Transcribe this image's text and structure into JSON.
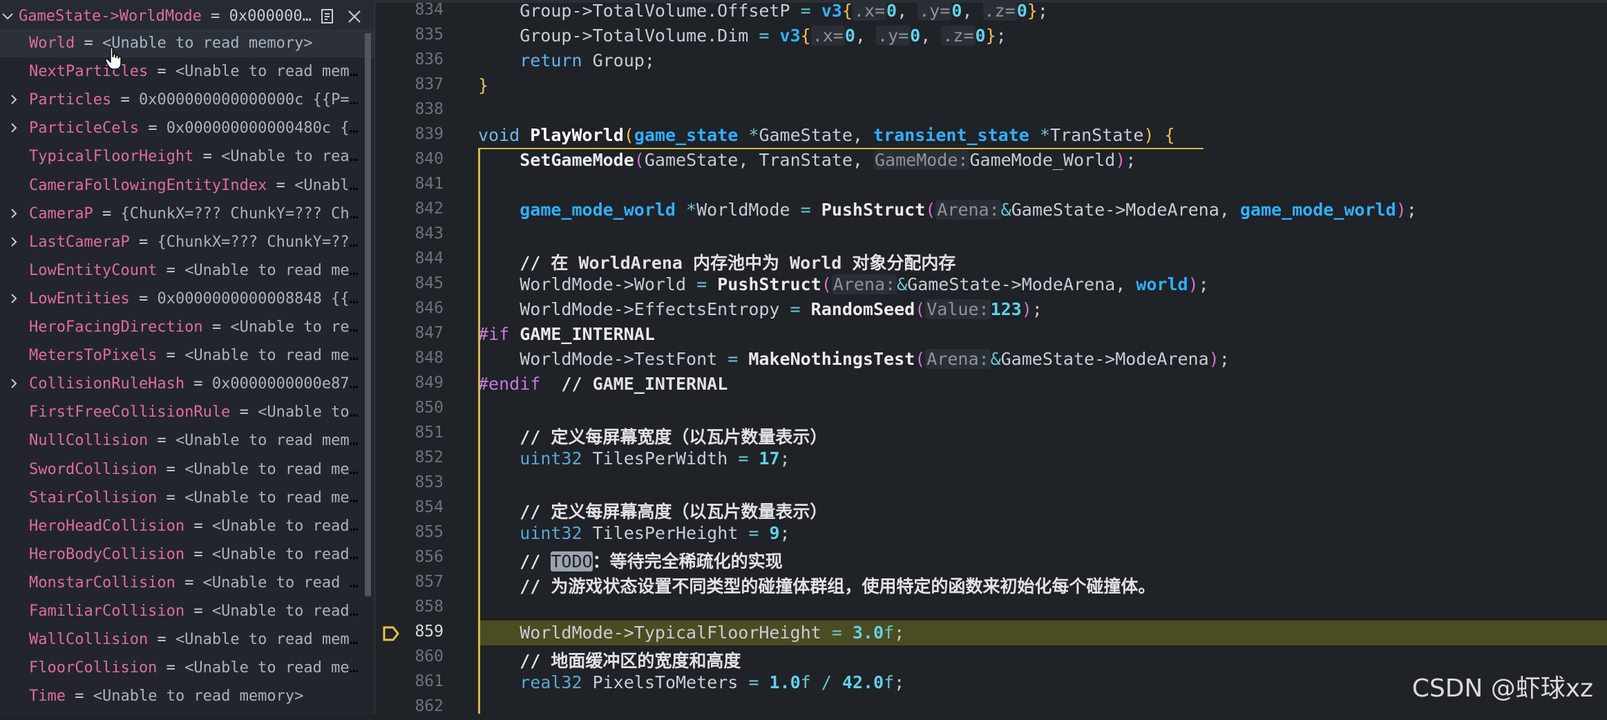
{
  "watch": {
    "header": {
      "name": "GameState->WorldMode",
      "eq": " = ",
      "value": "0x000000…"
    },
    "rows": [
      {
        "name": "World",
        "value": "<Unable to read memory>",
        "expandable": false
      },
      {
        "name": "NextParticles",
        "value": "<Unable to read memo…",
        "expandable": false
      },
      {
        "name": "Particles",
        "value": "0x000000000000000c {{P={…",
        "expandable": true
      },
      {
        "name": "ParticleCels",
        "value": "0x000000000000480c {0…",
        "expandable": true
      },
      {
        "name": "TypicalFloorHeight",
        "value": "<Unable to read…",
        "expandable": false
      },
      {
        "name": "CameraFollowingEntityIndex",
        "value": "<Unable…",
        "expandable": false
      },
      {
        "name": "CameraP",
        "value": "{ChunkX=??? ChunkY=??? Chu…",
        "expandable": true
      },
      {
        "name": "LastCameraP",
        "value": "{ChunkX=??? ChunkY=???…",
        "expandable": true
      },
      {
        "name": "LowEntityCount",
        "value": "<Unable to read mem…",
        "expandable": false
      },
      {
        "name": "LowEntities",
        "value": "0x0000000000008848 {{S…",
        "expandable": true
      },
      {
        "name": "HeroFacingDirection",
        "value": "<Unable to rea…",
        "expandable": false
      },
      {
        "name": "MetersToPixels",
        "value": "<Unable to read mem…",
        "expandable": false
      },
      {
        "name": "CollisionRuleHash",
        "value": "0x0000000000e877…",
        "expandable": true
      },
      {
        "name": "FirstFreeCollisionRule",
        "value": "<Unable to …",
        "expandable": false
      },
      {
        "name": "NullCollision",
        "value": "<Unable to read memo…",
        "expandable": false
      },
      {
        "name": "SwordCollision",
        "value": "<Unable to read mem…",
        "expandable": false
      },
      {
        "name": "StairCollision",
        "value": "<Unable to read mem…",
        "expandable": false
      },
      {
        "name": "HeroHeadCollision",
        "value": "<Unable to read …",
        "expandable": false
      },
      {
        "name": "HeroBodyCollision",
        "value": "<Unable to read …",
        "expandable": false
      },
      {
        "name": "MonstarCollision",
        "value": "<Unable to read m…",
        "expandable": false
      },
      {
        "name": "FamiliarCollision",
        "value": "<Unable to read …",
        "expandable": false
      },
      {
        "name": "WallCollision",
        "value": "<Unable to read memo…",
        "expandable": false
      },
      {
        "name": "FloorCollision",
        "value": "<Unable to read mem…",
        "expandable": false
      },
      {
        "name": "Time",
        "value": "<Unable to read memory>",
        "expandable": false
      }
    ]
  },
  "editor": {
    "lines": [
      {
        "n": "834",
        "segs": [
          [
            "",
            "    Group->TotalVolume.OffsetP "
          ],
          [
            "op",
            "="
          ],
          [
            "",
            " "
          ],
          [
            "ty",
            "v3"
          ],
          [
            "brk",
            "{"
          ],
          [
            "hint",
            ".x="
          ],
          [
            "num",
            "0"
          ],
          [
            "",
            ", "
          ],
          [
            "hint",
            ".y="
          ],
          [
            "num",
            "0"
          ],
          [
            "",
            ", "
          ],
          [
            "hint",
            ".z="
          ],
          [
            "num",
            "0"
          ],
          [
            "brk",
            "}"
          ],
          [
            "",
            ";"
          ]
        ]
      },
      {
        "n": "835",
        "segs": [
          [
            "",
            "    Group->TotalVolume.Dim "
          ],
          [
            "op",
            "="
          ],
          [
            "",
            " "
          ],
          [
            "ty",
            "v3"
          ],
          [
            "brk",
            "{"
          ],
          [
            "hint",
            ".x="
          ],
          [
            "num",
            "0"
          ],
          [
            "",
            ", "
          ],
          [
            "hint",
            ".y="
          ],
          [
            "num",
            "0"
          ],
          [
            "",
            ", "
          ],
          [
            "hint",
            ".z="
          ],
          [
            "num",
            "0"
          ],
          [
            "brk",
            "}"
          ],
          [
            "",
            ";"
          ]
        ]
      },
      {
        "n": "836",
        "segs": [
          [
            "",
            "    "
          ],
          [
            "kw",
            "return"
          ],
          [
            "",
            " Group;"
          ]
        ]
      },
      {
        "n": "837",
        "segs": [
          [
            "brk",
            "}"
          ]
        ]
      },
      {
        "n": "838",
        "segs": []
      },
      {
        "n": "839",
        "segs": [
          [
            "kw2",
            "void"
          ],
          [
            "",
            " "
          ],
          [
            "fn",
            "PlayWorld"
          ],
          [
            "brk",
            "("
          ],
          [
            "ty",
            "game_state"
          ],
          [
            "",
            " "
          ],
          [
            "ptr",
            "*"
          ],
          [
            "",
            "GameState, "
          ],
          [
            "ty",
            "transient_state"
          ],
          [
            "",
            " "
          ],
          [
            "ptr",
            "*"
          ],
          [
            "",
            "TranState"
          ],
          [
            "brk",
            ")"
          ],
          [
            "",
            " "
          ],
          [
            "brk",
            "{"
          ]
        ]
      },
      {
        "n": "840",
        "segs": [
          [
            "",
            "    "
          ],
          [
            "fn2",
            "SetGameMode"
          ],
          [
            "brk2",
            "("
          ],
          [
            "",
            "GameState, TranState, "
          ],
          [
            "hint",
            "GameMode:"
          ],
          [
            "",
            "GameMode_World"
          ],
          [
            "brk2",
            ")"
          ],
          [
            "",
            ";"
          ]
        ]
      },
      {
        "n": "841",
        "segs": []
      },
      {
        "n": "842",
        "segs": [
          [
            "",
            "    "
          ],
          [
            "ty",
            "game_mode_world"
          ],
          [
            "",
            " "
          ],
          [
            "ptr",
            "*"
          ],
          [
            "",
            "WorldMode "
          ],
          [
            "op",
            "="
          ],
          [
            "",
            " "
          ],
          [
            "fn2",
            "PushStruct"
          ],
          [
            "brk2",
            "("
          ],
          [
            "hint",
            "Arena:"
          ],
          [
            "ptr",
            "&"
          ],
          [
            "",
            "GameState->ModeArena, "
          ],
          [
            "ty",
            "game_mode_world"
          ],
          [
            "brk2",
            ")"
          ],
          [
            "",
            ";"
          ]
        ]
      },
      {
        "n": "843",
        "segs": []
      },
      {
        "n": "844",
        "segs": [
          [
            "com-bold",
            "    // 在 WorldArena 内存池中为 World 对象分配内存"
          ]
        ]
      },
      {
        "n": "845",
        "segs": [
          [
            "",
            "    WorldMode->World "
          ],
          [
            "op",
            "="
          ],
          [
            "",
            " "
          ],
          [
            "fn2",
            "PushStruct"
          ],
          [
            "brk2",
            "("
          ],
          [
            "hint",
            "Arena:"
          ],
          [
            "ptr",
            "&"
          ],
          [
            "",
            "GameState->ModeArena, "
          ],
          [
            "ty",
            "world"
          ],
          [
            "brk2",
            ")"
          ],
          [
            "",
            ";"
          ]
        ]
      },
      {
        "n": "846",
        "segs": [
          [
            "",
            "    WorldMode->EffectsEntropy "
          ],
          [
            "op",
            "="
          ],
          [
            "",
            " "
          ],
          [
            "fn2",
            "RandomSeed"
          ],
          [
            "brk2",
            "("
          ],
          [
            "hint",
            "Value:"
          ],
          [
            "num",
            "123"
          ],
          [
            "brk2",
            ")"
          ],
          [
            "",
            ";"
          ]
        ]
      },
      {
        "n": "847",
        "segs": [
          [
            "pp",
            "#if"
          ],
          [
            "",
            " "
          ],
          [
            "mac",
            "GAME_INTERNAL"
          ]
        ]
      },
      {
        "n": "848",
        "segs": [
          [
            "",
            "    WorldMode->TestFont "
          ],
          [
            "op",
            "="
          ],
          [
            "",
            " "
          ],
          [
            "fn2",
            "MakeNothingsTest"
          ],
          [
            "brk2",
            "("
          ],
          [
            "hint",
            "Arena:"
          ],
          [
            "ptr",
            "&"
          ],
          [
            "",
            "GameState->ModeArena"
          ],
          [
            "brk2",
            ")"
          ],
          [
            "",
            ";"
          ]
        ]
      },
      {
        "n": "849",
        "segs": [
          [
            "pp",
            "#endif"
          ],
          [
            "",
            "  "
          ],
          [
            "com-bold",
            "// GAME_INTERNAL"
          ]
        ]
      },
      {
        "n": "850",
        "segs": []
      },
      {
        "n": "851",
        "segs": [
          [
            "com-bold",
            "    // 定义每屏幕宽度（以瓦片数量表示）"
          ]
        ]
      },
      {
        "n": "852",
        "segs": [
          [
            "",
            "    "
          ],
          [
            "ty2",
            "uint32"
          ],
          [
            "",
            " TilesPerWidth "
          ],
          [
            "op",
            "="
          ],
          [
            "",
            " "
          ],
          [
            "num",
            "17"
          ],
          [
            "",
            ";"
          ]
        ]
      },
      {
        "n": "853",
        "segs": []
      },
      {
        "n": "854",
        "segs": [
          [
            "com-bold",
            "    // 定义每屏幕高度（以瓦片数量表示）"
          ]
        ]
      },
      {
        "n": "855",
        "segs": [
          [
            "",
            "    "
          ],
          [
            "ty2",
            "uint32"
          ],
          [
            "",
            " TilesPerHeight "
          ],
          [
            "op",
            "="
          ],
          [
            "",
            " "
          ],
          [
            "num",
            "9"
          ],
          [
            "",
            ";"
          ]
        ]
      },
      {
        "n": "856",
        "segs": [
          [
            "com-bold",
            "    // "
          ],
          [
            "todo",
            "TODO"
          ],
          [
            "com-bold",
            "：等待完全稀疏化的实现"
          ]
        ]
      },
      {
        "n": "857",
        "segs": [
          [
            "com-bold",
            "    // 为游戏状态设置不同类型的碰撞体群组，使用特定的函数来初始化每个碰撞体。"
          ]
        ]
      },
      {
        "n": "858",
        "segs": []
      },
      {
        "n": "859",
        "segs": [
          [
            "",
            "    WorldMode->TypicalFloorHeight "
          ],
          [
            "op",
            "="
          ],
          [
            "",
            " "
          ],
          [
            "num",
            "3.0"
          ],
          [
            "op",
            "f"
          ],
          [
            "",
            ";"
          ]
        ],
        "current": true
      },
      {
        "n": "860",
        "segs": [
          [
            "com-bold",
            "    // 地面缓冲区的宽度和高度"
          ]
        ]
      },
      {
        "n": "861",
        "segs": [
          [
            "",
            "    "
          ],
          [
            "ty2",
            "real32"
          ],
          [
            "",
            " PixelsToMeters "
          ],
          [
            "op",
            "="
          ],
          [
            "",
            " "
          ],
          [
            "num",
            "1.0"
          ],
          [
            "op",
            "f"
          ],
          [
            "",
            " "
          ],
          [
            "op",
            "/"
          ],
          [
            "",
            " "
          ],
          [
            "num",
            "42.0"
          ],
          [
            "op",
            "f"
          ],
          [
            "",
            ";"
          ]
        ]
      },
      {
        "n": "862",
        "segs": []
      }
    ]
  },
  "watermark": "CSDN @虾球xz"
}
